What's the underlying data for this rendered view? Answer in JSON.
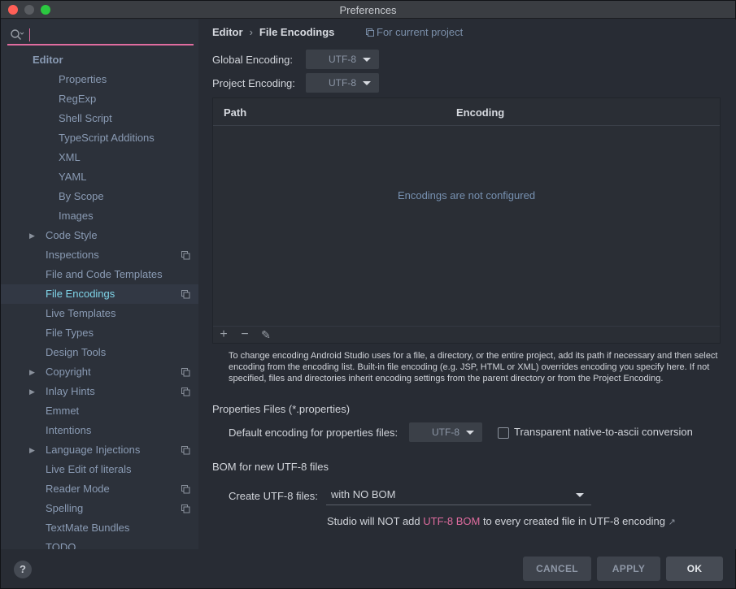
{
  "window": {
    "title": "Preferences"
  },
  "search": {
    "value": "",
    "placeholder": ""
  },
  "sidebar": {
    "items": [
      {
        "label": "Editor",
        "type": "header"
      },
      {
        "label": "Properties",
        "indent": 2
      },
      {
        "label": "RegExp",
        "indent": 2
      },
      {
        "label": "Shell Script",
        "indent": 2
      },
      {
        "label": "TypeScript Additions",
        "indent": 2
      },
      {
        "label": "XML",
        "indent": 2
      },
      {
        "label": "YAML",
        "indent": 2
      },
      {
        "label": "By Scope",
        "indent": 2
      },
      {
        "label": "Images",
        "indent": 2
      },
      {
        "label": "Code Style",
        "indent": 1,
        "expandable": true
      },
      {
        "label": "Inspections",
        "indent": 1,
        "project": true
      },
      {
        "label": "File and Code Templates",
        "indent": 1
      },
      {
        "label": "File Encodings",
        "indent": 1,
        "project": true,
        "selected": true
      },
      {
        "label": "Live Templates",
        "indent": 1
      },
      {
        "label": "File Types",
        "indent": 1
      },
      {
        "label": "Design Tools",
        "indent": 1
      },
      {
        "label": "Copyright",
        "indent": 1,
        "expandable": true,
        "project": true
      },
      {
        "label": "Inlay Hints",
        "indent": 1,
        "expandable": true,
        "project": true
      },
      {
        "label": "Emmet",
        "indent": 1
      },
      {
        "label": "Intentions",
        "indent": 1
      },
      {
        "label": "Language Injections",
        "indent": 1,
        "expandable": true,
        "project": true
      },
      {
        "label": "Live Edit of literals",
        "indent": 1
      },
      {
        "label": "Reader Mode",
        "indent": 1,
        "project": true
      },
      {
        "label": "Spelling",
        "indent": 1,
        "project": true
      },
      {
        "label": "TextMate Bundles",
        "indent": 1
      },
      {
        "label": "TODO",
        "indent": 1
      }
    ]
  },
  "breadcrumb": {
    "parent": "Editor",
    "separator": "›",
    "current": "File Encodings"
  },
  "for_current_project": "For current project",
  "global_encoding": {
    "label": "Global Encoding:",
    "value": "UTF-8"
  },
  "project_encoding": {
    "label": "Project Encoding:",
    "value": "UTF-8"
  },
  "table": {
    "columns": [
      "Path",
      "Encoding"
    ],
    "empty_text": "Encodings are not configured",
    "toolbar": {
      "add": "+",
      "remove": "−",
      "edit": "✎"
    }
  },
  "info_text": "To change encoding Android Studio uses for a file, a directory, or the entire project, add its path if necessary and then select encoding from the encoding list. Built-in file encoding (e.g. JSP, HTML or XML) overrides encoding you specify here. If not specified, files and directories inherit encoding settings from the parent directory or from the Project Encoding.",
  "properties": {
    "title": "Properties Files (*.properties)",
    "default_label": "Default encoding for properties files:",
    "default_value": "UTF-8",
    "transparent_label": "Transparent native-to-ascii conversion",
    "transparent_checked": false
  },
  "bom": {
    "title": "BOM for new UTF-8 files",
    "create_label": "Create UTF-8 files:",
    "create_value": "with NO BOM",
    "note_prefix": "Studio will NOT add ",
    "note_link": "UTF-8 BOM",
    "note_suffix": " to every created file in UTF-8 encoding",
    "note_arrow": "↗"
  },
  "buttons": {
    "cancel": "CANCEL",
    "apply": "APPLY",
    "ok": "OK"
  },
  "help": "?",
  "colors": {
    "accent": "#e06c9f",
    "selected_text": "#7fd4e8",
    "link": "#7791b1"
  }
}
